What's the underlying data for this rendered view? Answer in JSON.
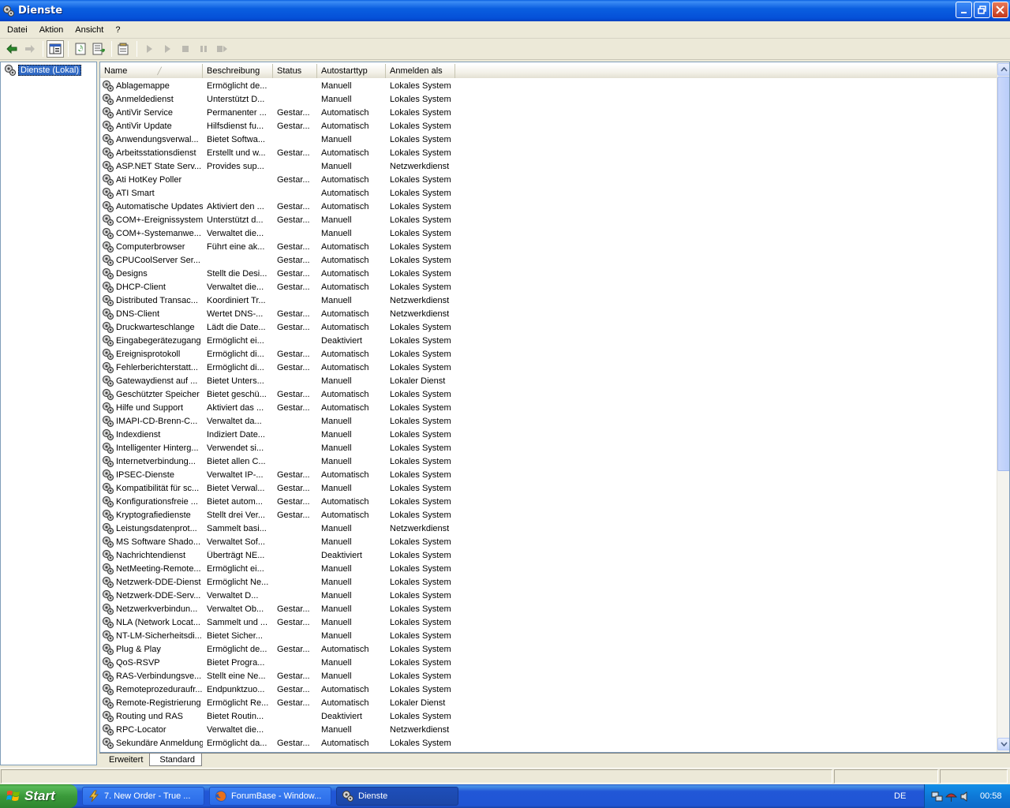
{
  "window": {
    "title": "Dienste"
  },
  "menu": [
    "Datei",
    "Aktion",
    "Ansicht",
    "?"
  ],
  "tree": {
    "root_label": "Dienste (Lokal)"
  },
  "columns": {
    "name": "Name",
    "description": "Beschreibung",
    "status": "Status",
    "startup": "Autostarttyp",
    "logon": "Anmelden als"
  },
  "services": [
    [
      "Ablagemappe",
      "Ermöglicht de...",
      "",
      "Manuell",
      "Lokales System"
    ],
    [
      "Anmeldedienst",
      "Unterstützt D...",
      "",
      "Manuell",
      "Lokales System"
    ],
    [
      "AntiVir Service",
      "Permanenter ...",
      "Gestar...",
      "Automatisch",
      "Lokales System"
    ],
    [
      "AntiVir Update",
      "Hilfsdienst fu...",
      "Gestar...",
      "Automatisch",
      "Lokales System"
    ],
    [
      "Anwendungsverwal...",
      "Bietet Softwa...",
      "",
      "Manuell",
      "Lokales System"
    ],
    [
      "Arbeitsstationsdienst",
      "Erstellt und w...",
      "Gestar...",
      "Automatisch",
      "Lokales System"
    ],
    [
      "ASP.NET State Serv...",
      "Provides sup...",
      "",
      "Manuell",
      "Netzwerkdienst"
    ],
    [
      "Ati HotKey Poller",
      "",
      "Gestar...",
      "Automatisch",
      "Lokales System"
    ],
    [
      "ATI Smart",
      "",
      "",
      "Automatisch",
      "Lokales System"
    ],
    [
      "Automatische Updates",
      "Aktiviert den ...",
      "Gestar...",
      "Automatisch",
      "Lokales System"
    ],
    [
      "COM+-Ereignissystem",
      "Unterstützt d...",
      "Gestar...",
      "Manuell",
      "Lokales System"
    ],
    [
      "COM+-Systemanwe...",
      "Verwaltet die...",
      "",
      "Manuell",
      "Lokales System"
    ],
    [
      "Computerbrowser",
      "Führt eine ak...",
      "Gestar...",
      "Automatisch",
      "Lokales System"
    ],
    [
      "CPUCoolServer Ser...",
      "",
      "Gestar...",
      "Automatisch",
      "Lokales System"
    ],
    [
      "Designs",
      "Stellt die Desi...",
      "Gestar...",
      "Automatisch",
      "Lokales System"
    ],
    [
      "DHCP-Client",
      "Verwaltet die...",
      "Gestar...",
      "Automatisch",
      "Lokales System"
    ],
    [
      "Distributed Transac...",
      "Koordiniert Tr...",
      "",
      "Manuell",
      "Netzwerkdienst"
    ],
    [
      "DNS-Client",
      "Wertet DNS-...",
      "Gestar...",
      "Automatisch",
      "Netzwerkdienst"
    ],
    [
      "Druckwarteschlange",
      "Lädt die Date...",
      "Gestar...",
      "Automatisch",
      "Lokales System"
    ],
    [
      "Eingabegerätezugang",
      "Ermöglicht ei...",
      "",
      "Deaktiviert",
      "Lokales System"
    ],
    [
      "Ereignisprotokoll",
      "Ermöglicht di...",
      "Gestar...",
      "Automatisch",
      "Lokales System"
    ],
    [
      "Fehlerberichterstatt...",
      "Ermöglicht di...",
      "Gestar...",
      "Automatisch",
      "Lokales System"
    ],
    [
      "Gatewaydienst auf ...",
      "Bietet Unters...",
      "",
      "Manuell",
      "Lokaler Dienst"
    ],
    [
      "Geschützter Speicher",
      "Bietet geschü...",
      "Gestar...",
      "Automatisch",
      "Lokales System"
    ],
    [
      "Hilfe und Support",
      "Aktiviert das ...",
      "Gestar...",
      "Automatisch",
      "Lokales System"
    ],
    [
      "IMAPI-CD-Brenn-C...",
      "Verwaltet da...",
      "",
      "Manuell",
      "Lokales System"
    ],
    [
      "Indexdienst",
      "Indiziert Date...",
      "",
      "Manuell",
      "Lokales System"
    ],
    [
      "Intelligenter Hinterg...",
      "Verwendet si...",
      "",
      "Manuell",
      "Lokales System"
    ],
    [
      "Internetverbindung...",
      "Bietet allen C...",
      "",
      "Manuell",
      "Lokales System"
    ],
    [
      "IPSEC-Dienste",
      "Verwaltet IP-...",
      "Gestar...",
      "Automatisch",
      "Lokales System"
    ],
    [
      "Kompatibilität für sc...",
      "Bietet Verwal...",
      "Gestar...",
      "Manuell",
      "Lokales System"
    ],
    [
      "Konfigurationsfreie ...",
      "Bietet autom...",
      "Gestar...",
      "Automatisch",
      "Lokales System"
    ],
    [
      "Kryptografiedienste",
      "Stellt drei Ver...",
      "Gestar...",
      "Automatisch",
      "Lokales System"
    ],
    [
      "Leistungsdatenprot...",
      "Sammelt basi...",
      "",
      "Manuell",
      "Netzwerkdienst"
    ],
    [
      "MS Software Shado...",
      "Verwaltet Sof...",
      "",
      "Manuell",
      "Lokales System"
    ],
    [
      "Nachrichtendienst",
      "Überträgt NE...",
      "",
      "Deaktiviert",
      "Lokales System"
    ],
    [
      "NetMeeting-Remote...",
      "Ermöglicht ei...",
      "",
      "Manuell",
      "Lokales System"
    ],
    [
      "Netzwerk-DDE-Dienst",
      "Ermöglicht Ne...",
      "",
      "Manuell",
      "Lokales System"
    ],
    [
      "Netzwerk-DDE-Serv...",
      "Verwaltet D...",
      "",
      "Manuell",
      "Lokales System"
    ],
    [
      "Netzwerkverbindun...",
      "Verwaltet Ob...",
      "Gestar...",
      "Manuell",
      "Lokales System"
    ],
    [
      "NLA (Network Locat...",
      "Sammelt und ...",
      "Gestar...",
      "Manuell",
      "Lokales System"
    ],
    [
      "NT-LM-Sicherheitsdi...",
      "Bietet Sicher...",
      "",
      "Manuell",
      "Lokales System"
    ],
    [
      "Plug & Play",
      "Ermöglicht de...",
      "Gestar...",
      "Automatisch",
      "Lokales System"
    ],
    [
      "QoS-RSVP",
      "Bietet Progra...",
      "",
      "Manuell",
      "Lokales System"
    ],
    [
      "RAS-Verbindungsve...",
      "Stellt eine Ne...",
      "Gestar...",
      "Manuell",
      "Lokales System"
    ],
    [
      "Remoteprozeduraufr...",
      "Endpunktzuo...",
      "Gestar...",
      "Automatisch",
      "Lokales System"
    ],
    [
      "Remote-Registrierung",
      "Ermöglicht Re...",
      "Gestar...",
      "Automatisch",
      "Lokaler Dienst"
    ],
    [
      "Routing und RAS",
      "Bietet Routin...",
      "",
      "Deaktiviert",
      "Lokales System"
    ],
    [
      "RPC-Locator",
      "Verwaltet die...",
      "",
      "Manuell",
      "Netzwerkdienst"
    ],
    [
      "Sekundäre Anmeldung",
      "Ermöglicht da...",
      "Gestar...",
      "Automatisch",
      "Lokales System"
    ]
  ],
  "tabs": [
    "Erweitert",
    "Standard"
  ],
  "taskbar": {
    "start": "Start",
    "tasks": [
      "7. New Order - True ...",
      "ForumBase - Window...",
      "Dienste"
    ],
    "lang": "DE",
    "clock": "00:58"
  }
}
